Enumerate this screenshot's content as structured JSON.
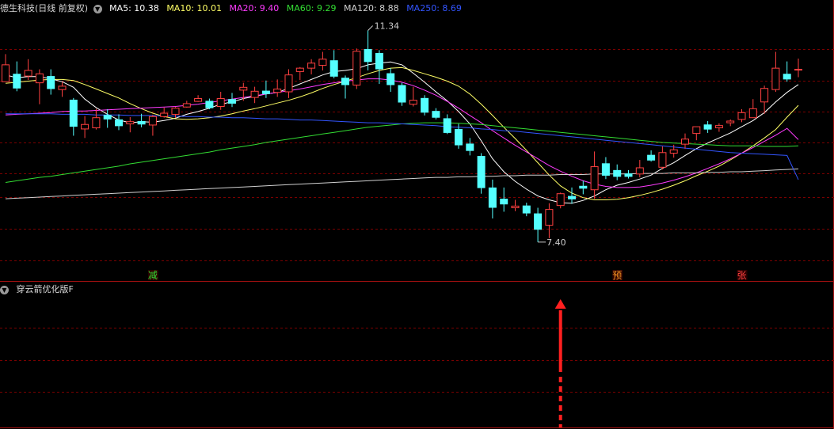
{
  "header": {
    "stock_title": "德生科技(日线 前复权)",
    "ma": [
      {
        "label": "MA5: 10.38",
        "color": "#ffffff"
      },
      {
        "label": "MA10: 10.01",
        "color": "#ffff66"
      },
      {
        "label": "MA20: 9.40",
        "color": "#ff3cff"
      },
      {
        "label": "MA60: 9.29",
        "color": "#33dd33"
      },
      {
        "label": "MA120: 8.88",
        "color": "#d0d0d0"
      },
      {
        "label": "MA250: 8.69",
        "color": "#3355ff"
      }
    ]
  },
  "indicator": {
    "title": "穿云箭优化版F"
  },
  "colors": {
    "up": "#ff4040",
    "down": "#54ffff",
    "grid": "#7a0000",
    "border": "#a01010"
  },
  "chart_data": {
    "type": "candlestick",
    "high_label": "11.34",
    "low_label": "7.40",
    "y_range": [
      7.1,
      11.6
    ],
    "signals": [
      {
        "text": "减",
        "index": 13,
        "color": "#33dd33"
      },
      {
        "text": "预",
        "index": 54,
        "color": "#ff9922"
      },
      {
        "text": "张",
        "index": 65,
        "color": "#ff4040"
      }
    ],
    "arrow_index": 49,
    "candles": [
      [
        10.43,
        10.73,
        10.48,
        10.92
      ],
      [
        10.57,
        10.31,
        10.26,
        10.79
      ],
      [
        10.53,
        10.63,
        10.46,
        10.83
      ],
      [
        10.41,
        10.57,
        10.03,
        10.65
      ],
      [
        10.53,
        10.3,
        10.2,
        10.65
      ],
      [
        10.29,
        10.35,
        10.16,
        10.42
      ],
      [
        10.11,
        9.63,
        9.47,
        10.14
      ],
      [
        9.59,
        9.67,
        9.43,
        9.82
      ],
      [
        9.61,
        9.79,
        9.58,
        9.95
      ],
      [
        9.84,
        9.76,
        9.61,
        9.94
      ],
      [
        9.76,
        9.64,
        9.57,
        9.85
      ],
      [
        9.68,
        9.72,
        9.53,
        9.8
      ],
      [
        9.73,
        9.67,
        9.62,
        9.86
      ],
      [
        9.66,
        9.81,
        9.47,
        9.84
      ],
      [
        9.81,
        9.87,
        9.79,
        9.97
      ],
      [
        9.85,
        9.96,
        9.79,
        9.98
      ],
      [
        9.98,
        10.04,
        9.97,
        10.09
      ],
      [
        10.08,
        10.13,
        10.07,
        10.19
      ],
      [
        10.09,
        9.96,
        9.94,
        10.13
      ],
      [
        9.99,
        10.13,
        9.93,
        10.25
      ],
      [
        10.12,
        10.04,
        9.98,
        10.23
      ],
      [
        10.28,
        10.33,
        10.09,
        10.41
      ],
      [
        10.15,
        10.26,
        10.05,
        10.34
      ],
      [
        10.27,
        10.21,
        10.14,
        10.45
      ],
      [
        10.24,
        10.3,
        10.16,
        10.47
      ],
      [
        10.25,
        10.55,
        10.14,
        10.65
      ],
      [
        10.61,
        10.67,
        10.46,
        10.69
      ],
      [
        10.67,
        10.76,
        10.56,
        10.83
      ],
      [
        10.72,
        10.83,
        10.63,
        10.96
      ],
      [
        10.81,
        10.52,
        10.49,
        10.99
      ],
      [
        10.5,
        10.37,
        10.13,
        10.54
      ],
      [
        10.37,
        10.97,
        10.3,
        11.02
      ],
      [
        11.01,
        10.78,
        10.63,
        11.34
      ],
      [
        10.94,
        10.65,
        10.39,
        10.99
      ],
      [
        10.58,
        10.37,
        10.25,
        10.67
      ],
      [
        10.37,
        10.06,
        10.0,
        10.41
      ],
      [
        10.03,
        10.1,
        9.99,
        10.34
      ],
      [
        10.14,
        9.88,
        9.83,
        10.19
      ],
      [
        9.91,
        9.79,
        9.76,
        9.96
      ],
      [
        9.78,
        9.52,
        9.5,
        9.85
      ],
      [
        9.59,
        9.3,
        9.24,
        9.68
      ],
      [
        9.33,
        9.2,
        9.12,
        9.43
      ],
      [
        9.11,
        8.54,
        8.44,
        9.16
      ],
      [
        8.55,
        8.19,
        8.0,
        8.69
      ],
      [
        8.35,
        8.25,
        8.12,
        8.55
      ],
      [
        8.19,
        8.22,
        8.13,
        8.33
      ],
      [
        8.23,
        8.09,
        8.04,
        8.28
      ],
      [
        8.09,
        7.8,
        7.58,
        8.19
      ],
      [
        7.88,
        8.16,
        7.65,
        8.27
      ],
      [
        8.23,
        8.44,
        8.18,
        8.46
      ],
      [
        8.4,
        8.34,
        8.26,
        8.55
      ],
      [
        8.58,
        8.53,
        8.43,
        8.67
      ],
      [
        8.51,
        8.92,
        8.35,
        9.19
      ],
      [
        8.98,
        8.76,
        8.7,
        9.09
      ],
      [
        8.86,
        8.74,
        8.68,
        8.96
      ],
      [
        8.8,
        8.74,
        8.71,
        8.86
      ],
      [
        8.79,
        8.9,
        8.73,
        9.04
      ],
      [
        9.13,
        9.03,
        9.01,
        9.21
      ],
      [
        8.91,
        9.17,
        8.87,
        9.28
      ],
      [
        9.16,
        9.22,
        9.08,
        9.31
      ],
      [
        9.32,
        9.41,
        9.24,
        9.51
      ],
      [
        9.51,
        9.63,
        9.39,
        9.61
      ],
      [
        9.67,
        9.58,
        9.52,
        9.73
      ],
      [
        9.61,
        9.65,
        9.54,
        9.69
      ],
      [
        9.7,
        9.73,
        9.64,
        9.76
      ],
      [
        9.76,
        9.88,
        9.71,
        9.94
      ],
      [
        9.79,
        9.95,
        9.79,
        10.12
      ],
      [
        10.07,
        10.31,
        9.86,
        10.36
      ],
      [
        10.29,
        10.67,
        10.25,
        10.96
      ],
      [
        10.57,
        10.47,
        10.43,
        10.79
      ],
      [
        10.65,
        10.65,
        10.51,
        10.84
      ]
    ],
    "ma_lines": [
      {
        "name": "MA5",
        "color": "#ffffff",
        "values": [
          10.55,
          10.5,
          10.52,
          10.52,
          10.48,
          10.43,
          10.33,
          10.12,
          9.97,
          9.85,
          9.75,
          9.7,
          9.72,
          9.71,
          9.74,
          9.78,
          9.85,
          9.9,
          9.96,
          10.03,
          10.07,
          10.13,
          10.17,
          10.21,
          10.24,
          10.31,
          10.39,
          10.47,
          10.55,
          10.61,
          10.63,
          10.66,
          10.73,
          10.76,
          10.78,
          10.73,
          10.58,
          10.42,
          10.25,
          10.09,
          9.9,
          9.68,
          9.38,
          9.06,
          8.83,
          8.66,
          8.52,
          8.4,
          8.33,
          8.28,
          8.27,
          8.32,
          8.4,
          8.51,
          8.59,
          8.64,
          8.7,
          8.77,
          8.89,
          8.99,
          9.12,
          9.24,
          9.34,
          9.43,
          9.52,
          9.63,
          9.74,
          9.88,
          10.07,
          10.24,
          10.38
        ]
      },
      {
        "name": "MA10",
        "color": "#ffff66",
        "values": [
          10.4,
          10.42,
          10.44,
          10.46,
          10.47,
          10.47,
          10.45,
          10.38,
          10.3,
          10.22,
          10.14,
          10.04,
          9.95,
          9.87,
          9.81,
          9.77,
          9.76,
          9.77,
          9.79,
          9.82,
          9.86,
          9.91,
          9.95,
          10.0,
          10.05,
          10.1,
          10.16,
          10.23,
          10.31,
          10.38,
          10.44,
          10.5,
          10.57,
          10.63,
          10.67,
          10.68,
          10.63,
          10.57,
          10.51,
          10.44,
          10.35,
          10.21,
          10.03,
          9.83,
          9.62,
          9.42,
          9.21,
          8.99,
          8.77,
          8.58,
          8.45,
          8.37,
          8.33,
          8.33,
          8.34,
          8.37,
          8.41,
          8.46,
          8.52,
          8.59,
          8.67,
          8.76,
          8.84,
          8.93,
          9.04,
          9.16,
          9.29,
          9.43,
          9.58,
          9.8,
          10.01
        ]
      },
      {
        "name": "MA20",
        "color": "#ff3cff",
        "values": [
          9.84,
          9.85,
          9.86,
          9.87,
          9.88,
          9.9,
          9.91,
          9.91,
          9.92,
          9.93,
          9.94,
          9.95,
          9.96,
          9.97,
          9.98,
          9.99,
          10.01,
          10.03,
          10.06,
          10.09,
          10.12,
          10.15,
          10.18,
          10.21,
          10.24,
          10.27,
          10.3,
          10.34,
          10.38,
          10.41,
          10.44,
          10.46,
          10.48,
          10.48,
          10.46,
          10.42,
          10.36,
          10.28,
          10.19,
          10.08,
          9.96,
          9.83,
          9.7,
          9.56,
          9.43,
          9.3,
          9.18,
          9.06,
          8.94,
          8.84,
          8.75,
          8.67,
          8.61,
          8.57,
          8.55,
          8.55,
          8.56,
          8.59,
          8.63,
          8.68,
          8.74,
          8.81,
          8.89,
          8.97,
          9.06,
          9.16,
          9.26,
          9.37,
          9.48,
          9.6,
          9.4
        ]
      },
      {
        "name": "MA60",
        "color": "#33dd33",
        "values": [
          8.64,
          8.67,
          8.7,
          8.73,
          8.75,
          8.78,
          8.81,
          8.84,
          8.87,
          8.9,
          8.93,
          8.97,
          9.0,
          9.03,
          9.06,
          9.09,
          9.12,
          9.15,
          9.18,
          9.22,
          9.25,
          9.28,
          9.31,
          9.35,
          9.38,
          9.41,
          9.44,
          9.47,
          9.5,
          9.53,
          9.56,
          9.59,
          9.62,
          9.64,
          9.66,
          9.68,
          9.69,
          9.7,
          9.7,
          9.7,
          9.69,
          9.68,
          9.67,
          9.65,
          9.63,
          9.61,
          9.59,
          9.57,
          9.55,
          9.53,
          9.51,
          9.49,
          9.47,
          9.45,
          9.43,
          9.41,
          9.39,
          9.37,
          9.35,
          9.34,
          9.33,
          9.32,
          9.31,
          9.3,
          9.29,
          9.29,
          9.29,
          9.28,
          9.28,
          9.28,
          9.29
        ]
      },
      {
        "name": "MA120",
        "color": "#d0d0d0",
        "values": [
          8.35,
          8.36,
          8.37,
          8.38,
          8.39,
          8.4,
          8.41,
          8.42,
          8.43,
          8.44,
          8.45,
          8.46,
          8.47,
          8.48,
          8.49,
          8.5,
          8.51,
          8.52,
          8.53,
          8.54,
          8.55,
          8.56,
          8.57,
          8.58,
          8.59,
          8.6,
          8.61,
          8.62,
          8.63,
          8.64,
          8.65,
          8.66,
          8.67,
          8.68,
          8.69,
          8.7,
          8.71,
          8.72,
          8.73,
          8.73,
          8.74,
          8.74,
          8.75,
          8.75,
          8.76,
          8.76,
          8.77,
          8.77,
          8.77,
          8.78,
          8.78,
          8.78,
          8.79,
          8.79,
          8.79,
          8.79,
          8.8,
          8.8,
          8.8,
          8.81,
          8.81,
          8.81,
          8.82,
          8.82,
          8.83,
          8.83,
          8.84,
          8.85,
          8.86,
          8.87,
          8.88
        ]
      },
      {
        "name": "MA250",
        "color": "#3355ff",
        "values": [
          9.86,
          9.86,
          9.86,
          9.86,
          9.86,
          9.85,
          9.85,
          9.85,
          9.84,
          9.84,
          9.84,
          9.83,
          9.83,
          9.83,
          9.82,
          9.82,
          9.81,
          9.81,
          9.8,
          9.8,
          9.79,
          9.79,
          9.78,
          9.77,
          9.77,
          9.76,
          9.75,
          9.75,
          9.74,
          9.73,
          9.72,
          9.71,
          9.7,
          9.7,
          9.69,
          9.68,
          9.67,
          9.66,
          9.65,
          9.63,
          9.62,
          9.61,
          9.59,
          9.58,
          9.56,
          9.55,
          9.53,
          9.51,
          9.49,
          9.47,
          9.45,
          9.43,
          9.41,
          9.39,
          9.37,
          9.35,
          9.33,
          9.31,
          9.29,
          9.27,
          9.25,
          9.23,
          9.21,
          9.19,
          9.17,
          9.16,
          9.15,
          9.14,
          9.13,
          9.12,
          8.69
        ]
      }
    ]
  }
}
